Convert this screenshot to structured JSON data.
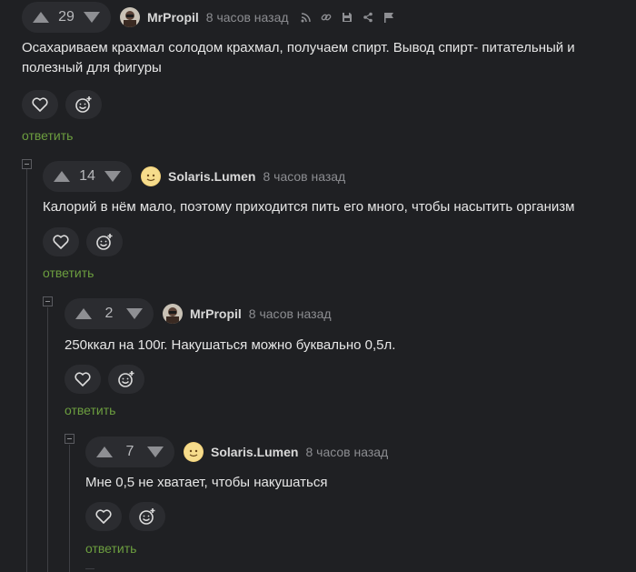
{
  "comments": [
    {
      "score": "29",
      "author": "MrPropil",
      "time": "8 часов назад",
      "text": "Осахариваем крахмал солодом крахмал, получаем спирт. Вывод спирт- питательный и полезный для фигуры",
      "reply_label": "ответить",
      "avatar": "dark-portrait",
      "tools": [
        "rss-icon",
        "link-icon",
        "save-icon",
        "share-icon",
        "flag-icon"
      ]
    },
    {
      "score": "14",
      "author": "Solaris.Lumen",
      "time": "8 часов назад",
      "text": "Калорий в нём мало, поэтому приходится пить его много, чтобы насытить организм",
      "reply_label": "ответить",
      "avatar": "yellow-face"
    },
    {
      "score": "2",
      "author": "MrPropil",
      "time": "8 часов назад",
      "text": "250ккал на 100г. Накушаться можно буквально 0,5л.",
      "reply_label": "ответить",
      "avatar": "dark-portrait"
    },
    {
      "score": "7",
      "author": "Solaris.Lumen",
      "time": "8 часов назад",
      "text": "Мне 0,5 не хватает, чтобы накушаться",
      "reply_label": "ответить",
      "avatar": "yellow-face"
    }
  ],
  "colors": {
    "background": "#1f2023",
    "reply_link": "#6c9e3f",
    "pill": "#2b2c30"
  }
}
